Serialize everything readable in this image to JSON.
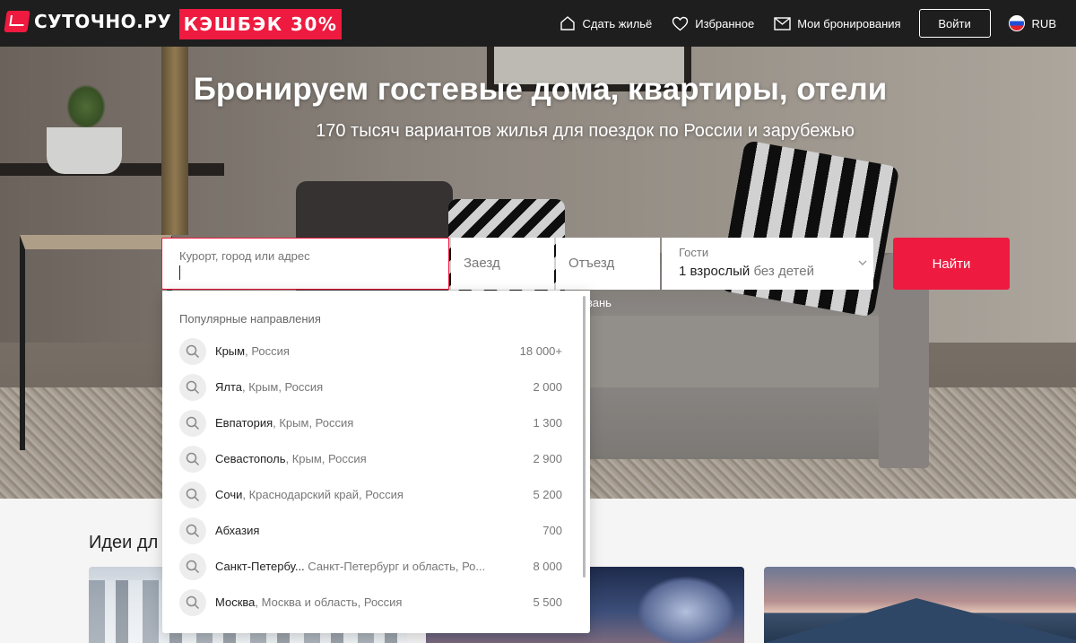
{
  "header": {
    "logo_text": "СУТОЧНО.РУ",
    "cashback_label": "КЭШБЭК 30",
    "cashback_suffix": "%",
    "nav": {
      "host": "Сдать жильё",
      "favorites": "Избранное",
      "bookings": "Мои бронирования"
    },
    "login": "Войти",
    "currency": "RUB"
  },
  "hero": {
    "title": "Бронируем гостевые дома, квартиры, отели",
    "subtitle": "170 тысяч вариантов жилья для поездок по России и зарубежью"
  },
  "search": {
    "place_placeholder": "Курорт, город или адрес",
    "checkin_label": "Заезд",
    "checkout_label": "Отъезд",
    "guests_label": "Гости",
    "guests_value": "1 взрослый",
    "guests_children": "без детей",
    "submit": "Найти",
    "partial_link": "вань"
  },
  "dropdown": {
    "heading": "Популярные направления",
    "items": [
      {
        "name": "Крым",
        "region": ", Россия",
        "count": "18 000+"
      },
      {
        "name": "Ялта",
        "region": ", Крым, Россия",
        "count": "2 000"
      },
      {
        "name": "Евпатория",
        "region": ", Крым, Россия",
        "count": "1 300"
      },
      {
        "name": "Севастополь",
        "region": ", Крым, Россия",
        "count": "2 900"
      },
      {
        "name": "Сочи",
        "region": ", Краснодарский край, Россия",
        "count": "5 200"
      },
      {
        "name": "Абхазия",
        "region": "",
        "count": "700"
      },
      {
        "name": "Санкт-Петербу...",
        "region": " Санкт-Петербург и область, Ро...",
        "count": "8 000"
      },
      {
        "name": "Москва",
        "region": ", Москва и область, Россия",
        "count": "5 500"
      }
    ]
  },
  "ideas": {
    "title_partial": "Идеи дл"
  },
  "colors": {
    "brand": "#ee1a3f",
    "topbar": "#1e1e1e"
  },
  "icons": [
    "logo-icon",
    "house-icon",
    "heart-icon",
    "mail-icon",
    "flag-ru-icon",
    "chevron-down-icon",
    "search-icon"
  ]
}
